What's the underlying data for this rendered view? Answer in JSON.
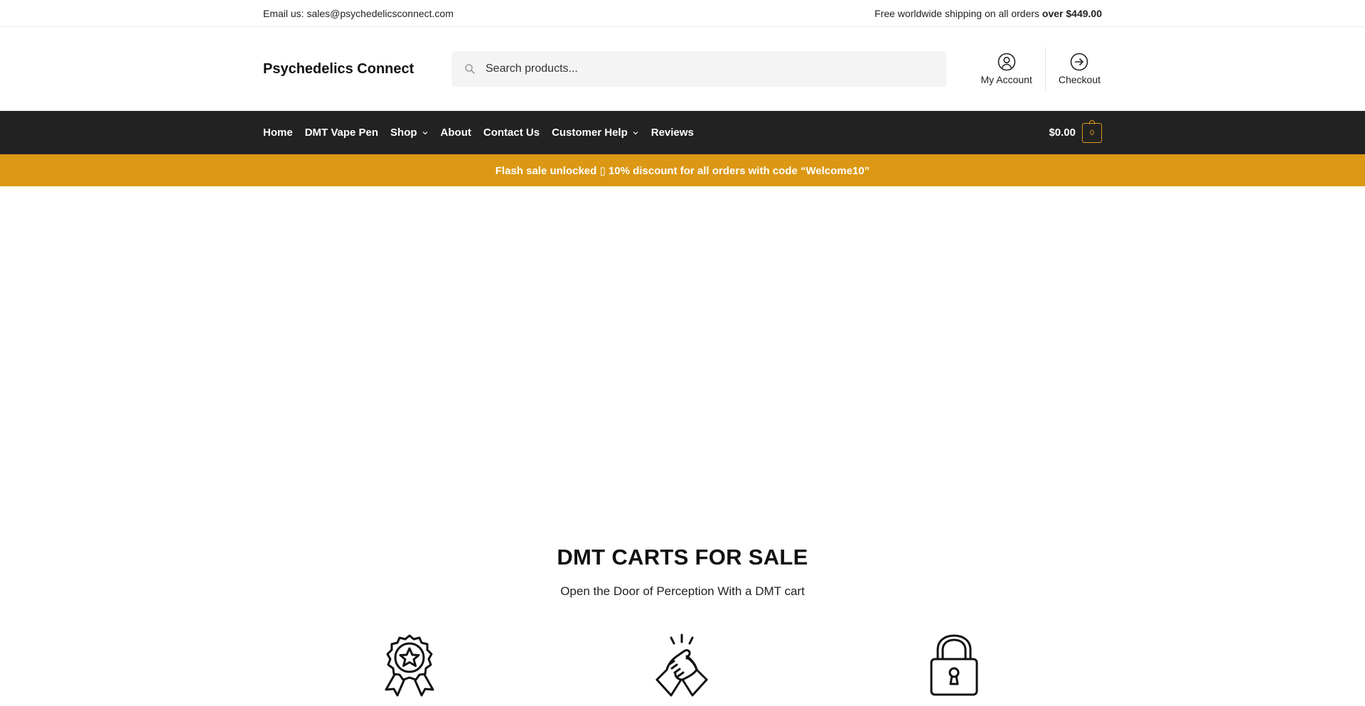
{
  "topbar": {
    "email": "Email us: sales@psychedelicsconnect.com",
    "shipping_text": "Free worldwide shipping on all orders ",
    "shipping_amount": "over $449.00"
  },
  "header": {
    "site_title": "Psychedelics Connect",
    "search_placeholder": "Search products...",
    "links": [
      {
        "label": "My Account",
        "icon": "user-circle-icon"
      },
      {
        "label": "Checkout",
        "icon": "arrow-right-circle-icon"
      }
    ]
  },
  "nav": {
    "items": [
      {
        "label": "Home"
      },
      {
        "label": "DMT Vape Pen"
      },
      {
        "label": "Shop",
        "has_dropdown": true
      },
      {
        "label": "About"
      },
      {
        "label": "Contact Us"
      },
      {
        "label": "Customer Help",
        "has_dropdown": true
      },
      {
        "label": "Reviews"
      }
    ],
    "cart_total": "$0.00",
    "cart_count": "0"
  },
  "banner": {
    "text": "Flash sale unlocked ▯ 10% discount for all orders with code “Welcome10”"
  },
  "hero": {
    "title": "DMT CARTS FOR SALE",
    "subtitle": "Open the Door of Perception With a DMT cart"
  },
  "features": [
    {
      "icon": "award-badge-icon"
    },
    {
      "icon": "handshake-icon"
    },
    {
      "icon": "padlock-icon"
    }
  ],
  "colors": {
    "accent": "#dc9814",
    "nav_bg": "#222222",
    "search_bg": "#f4f4f4"
  }
}
